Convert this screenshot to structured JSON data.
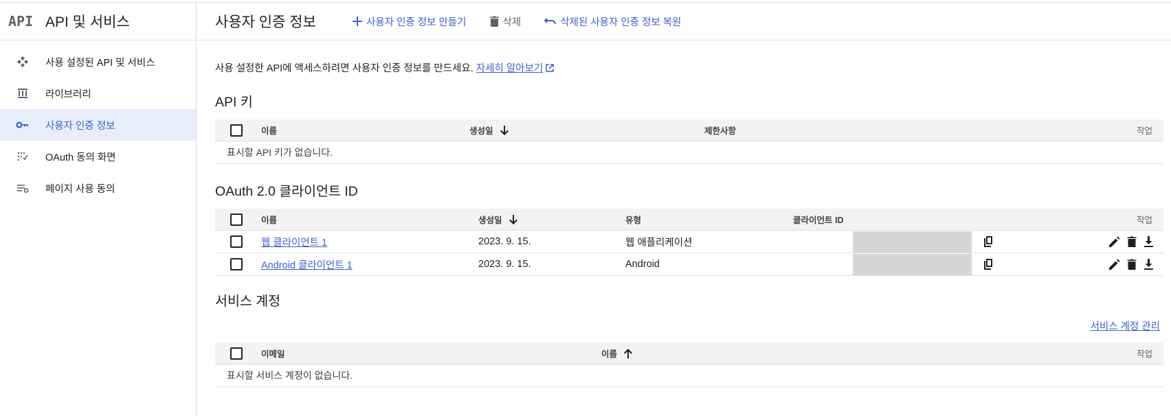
{
  "sidebar": {
    "logo": "API",
    "title": "API 및 서비스",
    "items": [
      {
        "label": "사용 설정된 API 및 서비스",
        "icon": "diamond-arrows-icon"
      },
      {
        "label": "라이브러리",
        "icon": "library-icon"
      },
      {
        "label": "사용자 인증 정보",
        "icon": "key-icon",
        "active": true
      },
      {
        "label": "OAuth 동의 화면",
        "icon": "consent-dots-icon"
      },
      {
        "label": "페이지 사용 동의",
        "icon": "settings-list-icon"
      }
    ]
  },
  "toolbar": {
    "title": "사용자 인증 정보",
    "create_label": "사용자 인증 정보 만들기",
    "delete_label": "삭제",
    "restore_label": "삭제된 사용자 인증 정보 복원"
  },
  "intro": {
    "text": "사용 설정한 API에 액세스하려면 사용자 인증 정보를 만드세요.",
    "link": "자세히 알아보기"
  },
  "api_keys": {
    "title": "API 키",
    "columns": {
      "name": "이름",
      "created": "생성일",
      "restrictions": "제한사항",
      "actions": "작업"
    },
    "empty": "표시할 API 키가 없습니다."
  },
  "oauth": {
    "title": "OAuth 2.0 클라이언트 ID",
    "columns": {
      "name": "이름",
      "created": "생성일",
      "type": "유형",
      "client_id": "클라이언트 ID",
      "actions": "작업"
    },
    "rows": [
      {
        "name": "웹 클라이언트 1",
        "created": "2023. 9. 15.",
        "type": "웹 애플리케이션"
      },
      {
        "name": "Android 클라이언트 1",
        "created": "2023. 9. 15.",
        "type": "Android"
      }
    ]
  },
  "service_accounts": {
    "title": "서비스 계정",
    "manage_link": "서비스 계정 관리",
    "columns": {
      "email": "이메일",
      "name": "이름",
      "actions": "작업"
    },
    "empty": "표시할 서비스 계정이 없습니다."
  },
  "colors": {
    "accent": "#3c5fd1",
    "active_bg": "#e8eef9",
    "header_bg": "#f3f3f3",
    "redaction": "#d6d6d6"
  }
}
